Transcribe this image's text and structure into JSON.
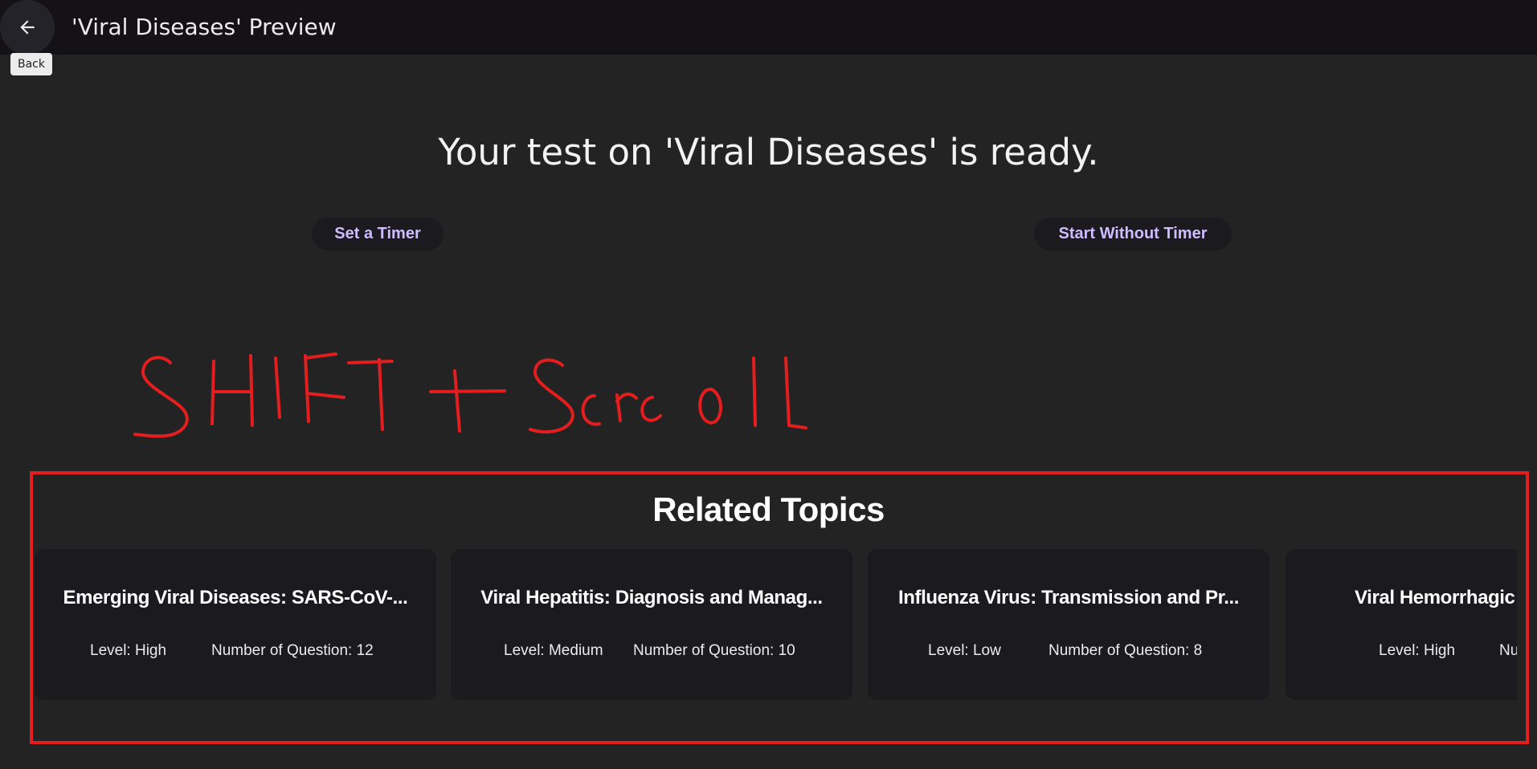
{
  "app_bar": {
    "title": "'Viral Diseases' Preview",
    "back_icon": "arrow-left-icon",
    "back_tooltip": "Back"
  },
  "main": {
    "heading": "Your test on 'Viral Diseases' is ready.",
    "set_timer_label": "Set a Timer",
    "start_without_timer_label": "Start Without Timer"
  },
  "annotation": {
    "handwritten_text": "SHIFT + Scroll",
    "color": "#e41e1e"
  },
  "related": {
    "heading": "Related Topics",
    "cards": [
      {
        "title": "Emerging Viral Diseases: SARS-CoV-...",
        "level": "Level: High",
        "count": "Number of Question: 12"
      },
      {
        "title": "Viral Hepatitis: Diagnosis and Manag...",
        "level": "Level: Medium",
        "count": "Number of Question: 10"
      },
      {
        "title": "Influenza Virus: Transmission and Pr...",
        "level": "Level: Low",
        "count": "Number of Question: 8"
      },
      {
        "title": "Viral Hemorrhagic Feve",
        "level": "Level: High",
        "count": "Numbe"
      }
    ]
  },
  "colors": {
    "background": "#232323",
    "app_bar": "#141217",
    "card": "#1b1a1f",
    "accent": "#cfbcff",
    "annotation": "#e41e1e"
  }
}
